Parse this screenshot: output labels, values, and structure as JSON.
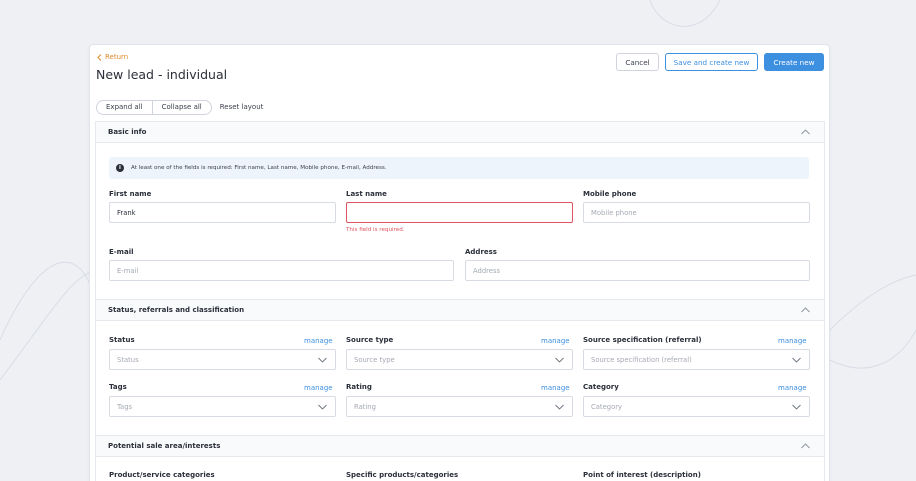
{
  "header": {
    "return_label": "Return",
    "title": "New lead - individual",
    "cancel_label": "Cancel",
    "save_create_label": "Save and create new",
    "create_label": "Create new"
  },
  "toolbar": {
    "expand_all": "Expand all",
    "collapse_all": "Collapse all",
    "reset_layout": "Reset layout"
  },
  "basic_info": {
    "title": "Basic info",
    "notice": "At least one of the fields is required: First name, Last name, Mobile phone, E-mail, Address.",
    "first_name": {
      "label": "First name",
      "value": "Frank"
    },
    "last_name": {
      "label": "Last name",
      "value": "",
      "error": "This field is required."
    },
    "mobile_phone": {
      "label": "Mobile phone",
      "placeholder": "Mobile phone"
    },
    "email": {
      "label": "E-mail",
      "placeholder": "E-mail"
    },
    "address": {
      "label": "Address",
      "placeholder": "Address"
    }
  },
  "status_section": {
    "title": "Status, referrals and classification",
    "manage_label": "manage",
    "status": {
      "label": "Status",
      "placeholder": "Status"
    },
    "source_type": {
      "label": "Source type",
      "placeholder": "Source type"
    },
    "source_spec": {
      "label": "Source specification (referral)",
      "placeholder": "Source specification (referral)"
    },
    "tags": {
      "label": "Tags",
      "placeholder": "Tags"
    },
    "rating": {
      "label": "Rating",
      "placeholder": "Rating"
    },
    "category": {
      "label": "Category",
      "placeholder": "Category"
    }
  },
  "interests_section": {
    "title": "Potential sale area/interests",
    "product_categories": {
      "label": "Product/service categories"
    },
    "specific_products": {
      "label": "Specific products/categories"
    },
    "point_of_interest": {
      "label": "Point of interest (description)"
    }
  },
  "colors": {
    "accent": "#3d8fe0",
    "return_link": "#e08a2c",
    "error": "#e05260",
    "background": "#eef0f4"
  }
}
